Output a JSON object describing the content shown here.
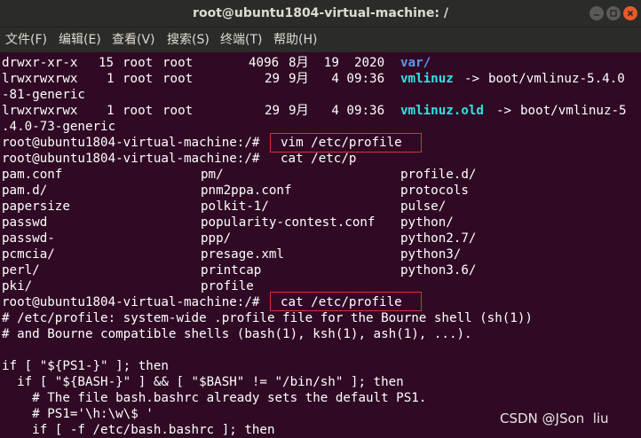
{
  "window": {
    "title": "root@ubuntu1804-virtual-machine: /"
  },
  "menu": {
    "items": [
      "文件(F)",
      "编辑(E)",
      "查看(V)",
      "搜索(S)",
      "终端(T)",
      "帮助(H)"
    ]
  },
  "terminal": {
    "listing": [
      {
        "perms": "drwxr-xr-x",
        "links": "15",
        "owner": "root",
        "group": "root",
        "size": "4096",
        "date": "8月  19  2020",
        "name": "var/"
      },
      {
        "perms": "lrwxrwxrwx",
        "links": "1",
        "owner": "root",
        "group": "root",
        "size": "29",
        "date": "9月   4 09:36",
        "name": "vmlinuz",
        "arrow": "->",
        "target": "boot/vmlinuz-5.4.0",
        "target_cont": "-81-generic"
      },
      {
        "perms": "lrwxrwxrwx",
        "links": "1",
        "owner": "root",
        "group": "root",
        "size": "29",
        "date": "9月   4 09:36",
        "name": "vmlinuz.old",
        "arrow": "->",
        "target": "boot/vmlinuz-5",
        "target_cont": ".4.0-73-generic"
      }
    ],
    "prompt": "root@ubuntu1804-virtual-machine:/#",
    "cmd1": "vim /etc/profile",
    "cmd2": "cat /etc/p",
    "completions": [
      [
        "pam.conf",
        "pm/",
        "profile.d/"
      ],
      [
        "pam.d/",
        "pnm2ppa.conf",
        "protocols"
      ],
      [
        "papersize",
        "polkit-1/",
        "pulse/"
      ],
      [
        "passwd",
        "popularity-contest.conf",
        "python/"
      ],
      [
        "passwd-",
        "ppp/",
        "python2.7/"
      ],
      [
        "pcmcia/",
        "presage.xml",
        "python3/"
      ],
      [
        "perl/",
        "printcap",
        "python3.6/"
      ],
      [
        "pki/",
        "profile",
        ""
      ]
    ],
    "cmd3": "cat /etc/profile",
    "output": [
      "# /etc/profile: system-wide .profile file for the Bourne shell (sh(1))",
      "# and Bourne compatible shells (bash(1), ksh(1), ash(1), ...).",
      "",
      "if [ \"${PS1-}\" ]; then",
      "  if [ \"${BASH-}\" ] && [ \"$BASH\" != \"/bin/sh\" ]; then",
      "    # The file bash.bashrc already sets the default PS1.",
      "    # PS1='\\h:\\w\\$ '",
      "    if [ -f /etc/bash.bashrc ]; then"
    ]
  },
  "watermark": "CSDN @JSon  liu",
  "colors": {
    "terminal_bg": "#300a24",
    "titlebar_bg": "#2b2b29",
    "dir_blue": "#5c99ea",
    "link_cyan": "#34e2e2",
    "highlight_red": "#d8303a",
    "close_orange": "#e9592b"
  }
}
